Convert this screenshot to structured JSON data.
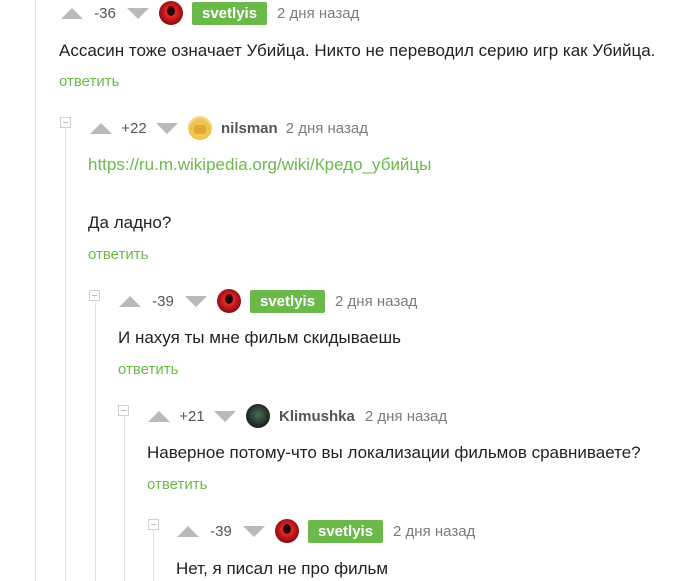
{
  "comments": [
    {
      "rating": "-36",
      "author": "svetlyis",
      "time": "2 дня назад",
      "text": "Ассасин тоже означает Убийца. Никто не переводил серию игр как Убийца.",
      "reply": "ответить"
    },
    {
      "rating": "+22",
      "author": "nilsman",
      "time": "2 дня назад",
      "link": "https://ru.m.wikipedia.org/wiki/Кредо_убийцы",
      "text": "Да ладно?",
      "reply": "ответить"
    },
    {
      "rating": "-39",
      "author": "svetlyis",
      "time": "2 дня назад",
      "text": "И нахуя ты мне фильм скидываешь",
      "reply": "ответить"
    },
    {
      "rating": "+21",
      "author": "Klimushka",
      "time": "2 дня назад",
      "text": "Наверное потому-что вы локализации фильмов сравниваете?",
      "reply": "ответить"
    },
    {
      "rating": "-39",
      "author": "svetlyis",
      "time": "2 дня назад",
      "text": "Нет, я писал не про фильм"
    }
  ],
  "colors": {
    "accent": "#6cb94b",
    "arrow": "#b9b9b9",
    "line": "#e2e2e2"
  }
}
